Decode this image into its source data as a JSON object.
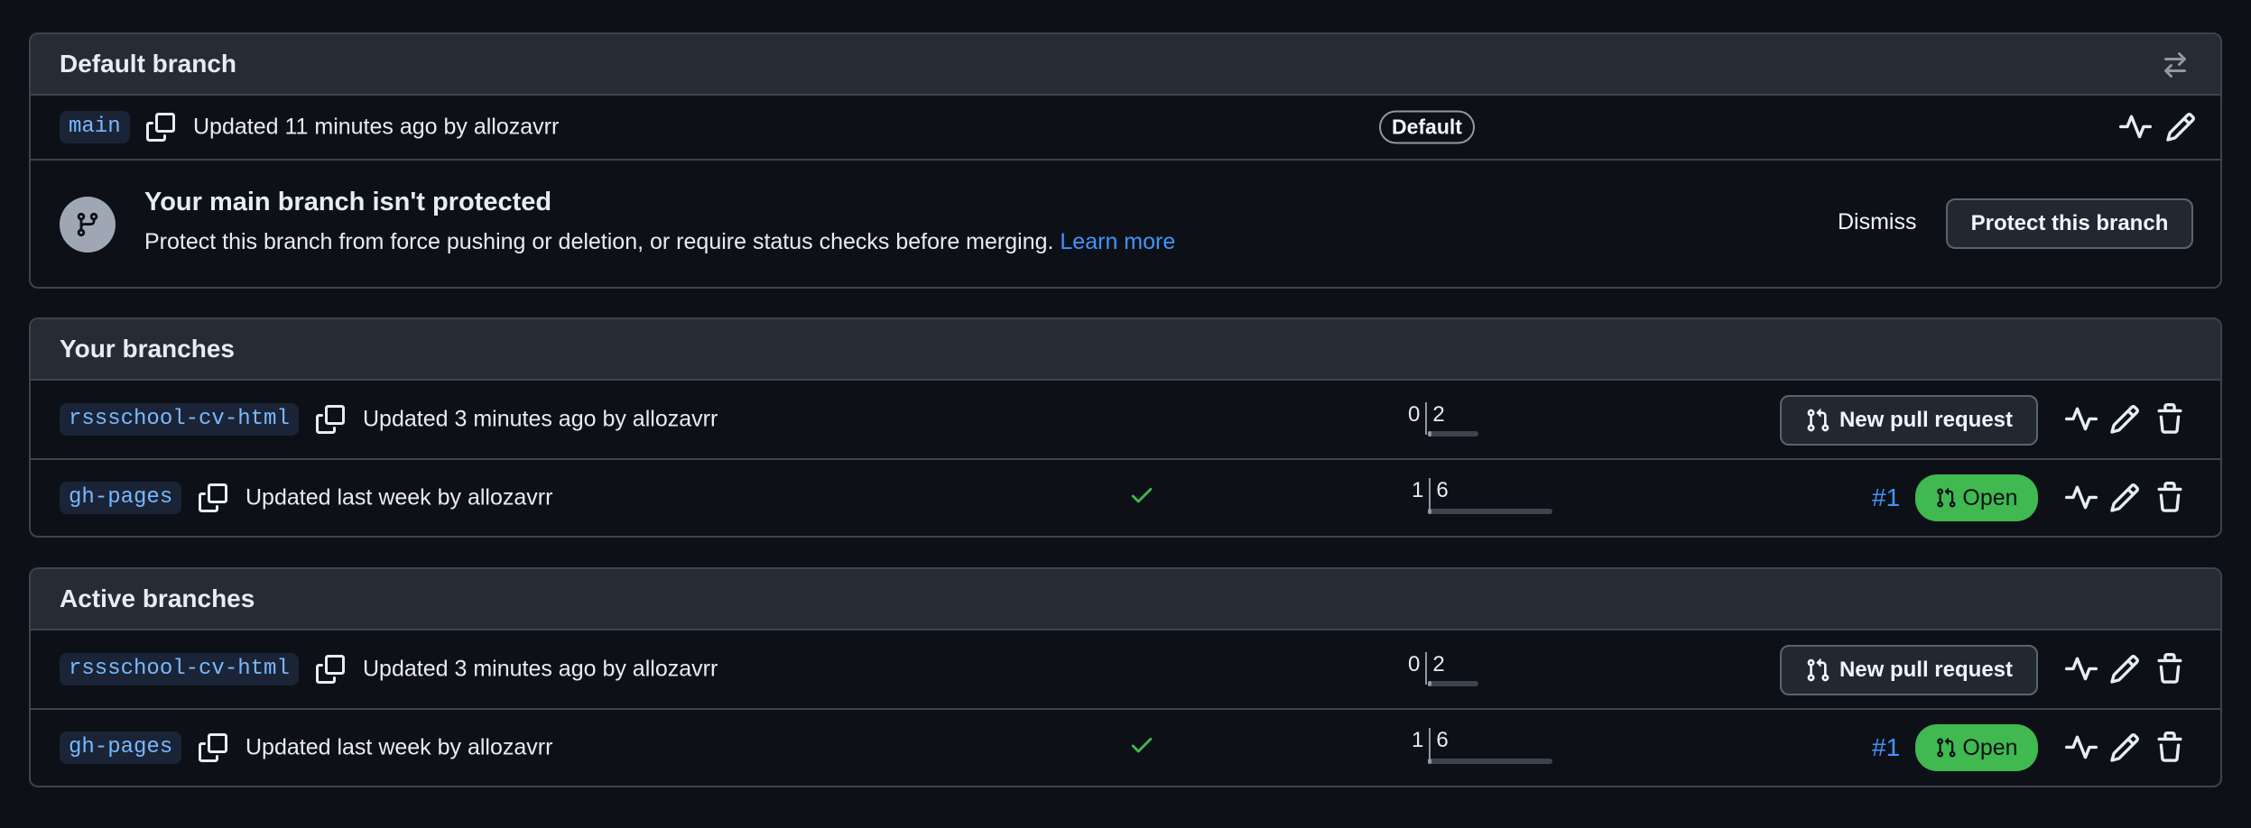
{
  "default_section": {
    "title": "Default branch",
    "branch": {
      "name": "main",
      "updated": "Updated 11 minutes ago by allozavrr",
      "badge": "Default"
    },
    "notice": {
      "title": "Your main branch isn't protected",
      "text": "Protect this branch from force pushing or deletion, or require status checks before merging.",
      "link": "Learn more",
      "dismiss_label": "Dismiss",
      "protect_label": "Protect this branch"
    }
  },
  "your_section": {
    "title": "Your branches",
    "rows": [
      {
        "name": "rssschool-cv-html",
        "updated": "Updated 3 minutes ago by allozavrr",
        "behind": "0",
        "ahead": "2",
        "action_label": "New pull request"
      },
      {
        "name": "gh-pages",
        "updated": "Updated last week by allozavrr",
        "behind": "1",
        "ahead": "6",
        "pr_number": "#1",
        "pr_status": "Open"
      }
    ]
  },
  "active_section": {
    "title": "Active branches",
    "rows": [
      {
        "name": "rssschool-cv-html",
        "updated": "Updated 3 minutes ago by allozavrr",
        "behind": "0",
        "ahead": "2",
        "action_label": "New pull request"
      },
      {
        "name": "gh-pages",
        "updated": "Updated last week by allozavrr",
        "behind": "1",
        "ahead": "6",
        "pr_number": "#1",
        "pr_status": "Open"
      }
    ]
  },
  "colors": {
    "background": "#0d1117",
    "header_bg": "#262c36",
    "border": "#3d444d",
    "link": "#4493f8",
    "open_green": "#3fb950",
    "check_green": "#3fb950"
  },
  "icons": [
    "switch-arrows-icon",
    "copy-icon",
    "activity-icon",
    "pencil-icon",
    "trash-icon",
    "git-branch-icon",
    "git-pull-request-icon",
    "check-icon"
  ]
}
